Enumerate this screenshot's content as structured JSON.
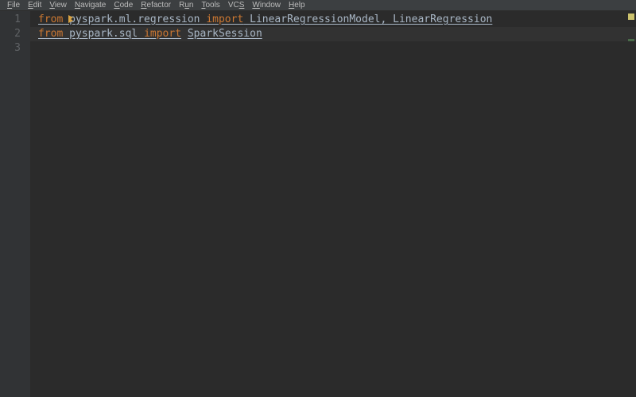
{
  "menubar": {
    "items": [
      {
        "label": "File",
        "accel": "F"
      },
      {
        "label": "Edit",
        "accel": "E"
      },
      {
        "label": "View",
        "accel": "V"
      },
      {
        "label": "Navigate",
        "accel": "N"
      },
      {
        "label": "Code",
        "accel": "C"
      },
      {
        "label": "Refactor",
        "accel": "R"
      },
      {
        "label": "Run",
        "accel": "u"
      },
      {
        "label": "Tools",
        "accel": "T"
      },
      {
        "label": "VCS",
        "accel": "S"
      },
      {
        "label": "Window",
        "accel": "W"
      },
      {
        "label": "Help",
        "accel": "H"
      }
    ]
  },
  "gutter": {
    "lines": [
      "1",
      "2",
      "3"
    ]
  },
  "code": {
    "line1": {
      "kw_from": "from",
      "mod": " pyspark.ml.regression ",
      "kw_import": "import",
      "imports": " LinearRegressionModel, LinearRegression"
    },
    "line2": {
      "kw_from": "from",
      "mod": " pyspark.sql ",
      "kw_import": "import",
      "space": " ",
      "cls": "SparkSession"
    }
  },
  "indicators": {
    "warning_color": "#ccc26d",
    "ok_color": "#4a6b4a"
  }
}
